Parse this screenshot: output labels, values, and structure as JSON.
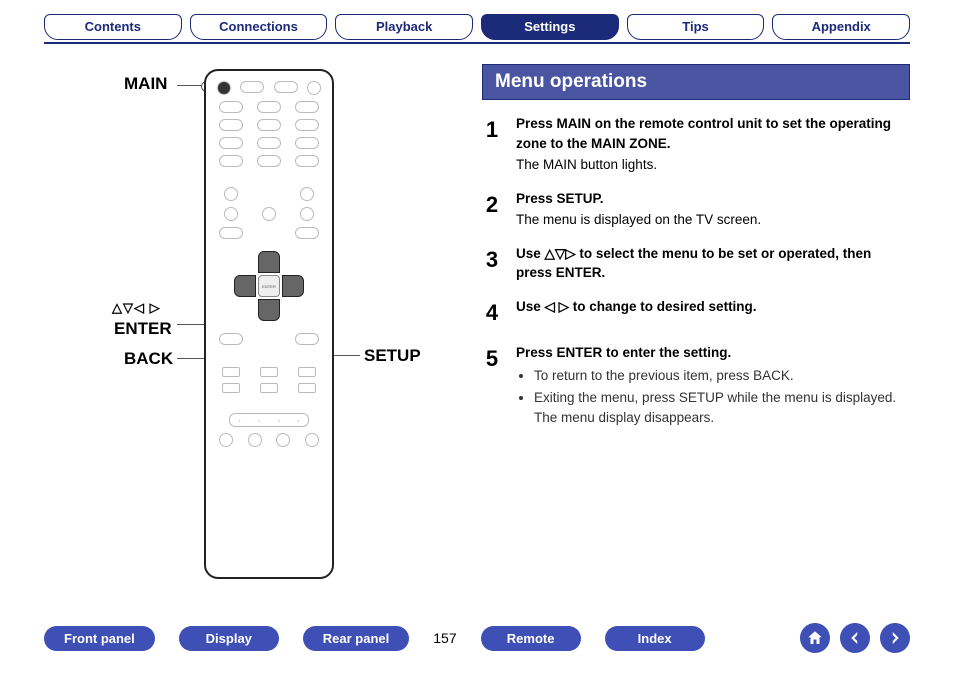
{
  "topTabs": [
    {
      "label": "Contents",
      "active": false
    },
    {
      "label": "Connections",
      "active": false
    },
    {
      "label": "Playback",
      "active": false
    },
    {
      "label": "Settings",
      "active": true
    },
    {
      "label": "Tips",
      "active": false
    },
    {
      "label": "Appendix",
      "active": false
    }
  ],
  "remote": {
    "labels": {
      "main": "MAIN",
      "arrows": "△▽◁ ▷",
      "enter": "ENTER",
      "back": "BACK",
      "setup": "SETUP"
    }
  },
  "section": {
    "title": "Menu operations",
    "steps": [
      {
        "num": "1",
        "bold": "Press MAIN on the remote control unit to set the operating zone to the MAIN ZONE.",
        "sub": "The MAIN button lights."
      },
      {
        "num": "2",
        "bold": "Press SETUP.",
        "sub": "The menu is displayed on the TV screen."
      },
      {
        "num": "3",
        "bold": "Use △▽▷ to select the menu to be set or operated, then press ENTER."
      },
      {
        "num": "4",
        "bold": "Use ◁ ▷ to change to desired setting."
      },
      {
        "num": "5",
        "bold": "Press ENTER to enter the setting.",
        "bullets": [
          "To return to the previous item, press BACK.",
          "Exiting the menu, press SETUP while the menu is displayed. The menu display disappears."
        ]
      }
    ]
  },
  "bottom": {
    "buttons": [
      "Front panel",
      "Display",
      "Rear panel"
    ],
    "page": "157",
    "buttons2": [
      "Remote",
      "Index"
    ]
  }
}
